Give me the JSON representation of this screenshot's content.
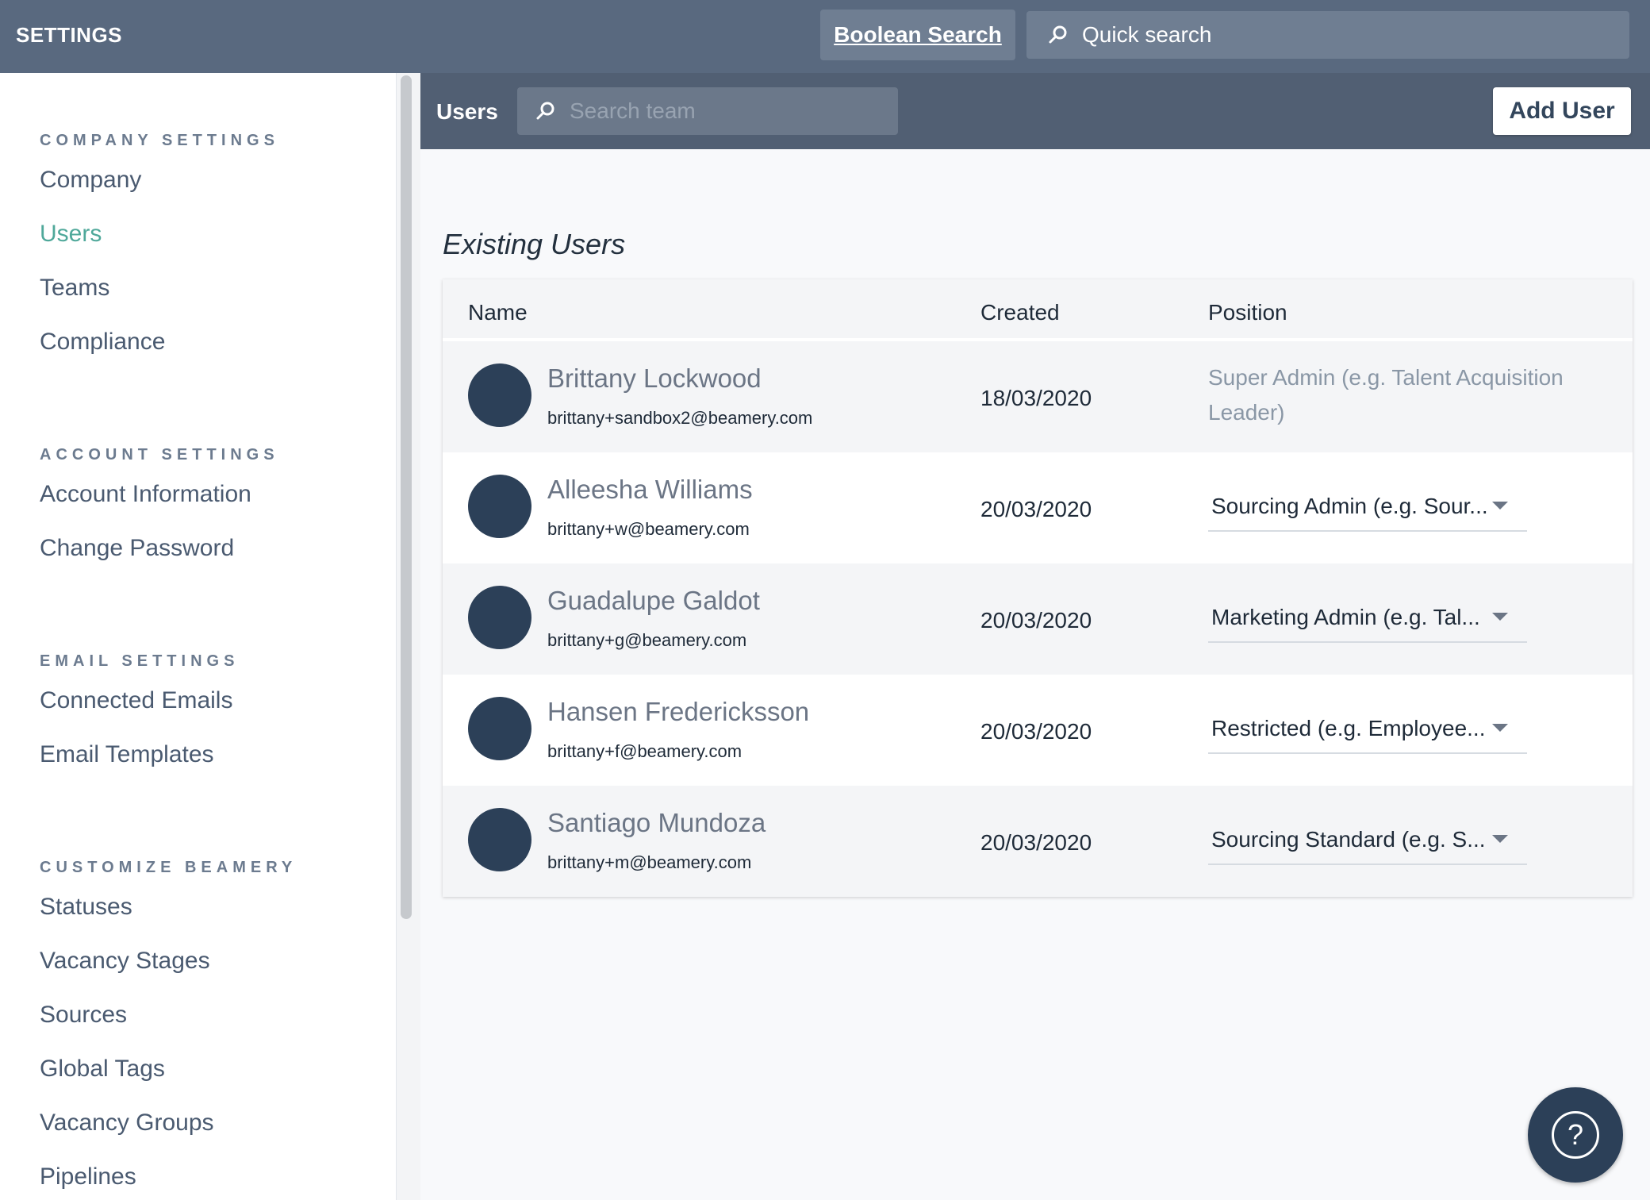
{
  "topbar": {
    "title": "SETTINGS",
    "boolean_search_label": "Boolean Search",
    "quick_search_placeholder": "Quick search"
  },
  "sidebar": {
    "sections": [
      {
        "title": "COMPANY SETTINGS",
        "items": [
          "Company",
          "Users",
          "Teams",
          "Compliance"
        ]
      },
      {
        "title": "ACCOUNT SETTINGS",
        "items": [
          "Account Information",
          "Change Password"
        ]
      },
      {
        "title": "EMAIL SETTINGS",
        "items": [
          "Connected Emails",
          "Email Templates"
        ]
      },
      {
        "title": "CUSTOMIZE BEAMERY",
        "items": [
          "Statuses",
          "Vacancy Stages",
          "Sources",
          "Global Tags",
          "Vacancy Groups",
          "Pipelines"
        ]
      }
    ],
    "active_item": "Users"
  },
  "content_header": {
    "title": "Users",
    "search_placeholder": "Search team",
    "add_user_label": "Add User"
  },
  "main": {
    "heading": "Existing Users",
    "columns": [
      "Name",
      "Created",
      "Position"
    ],
    "users": [
      {
        "name": "Brittany Lockwood",
        "email": "brittany+sandbox2@beamery.com",
        "created": "18/03/2020",
        "position": "Super Admin (e.g. Talent Acquisition Leader)",
        "editable": false
      },
      {
        "name": "Alleesha Williams",
        "email": "brittany+w@beamery.com",
        "created": "20/03/2020",
        "position": "Sourcing Admin (e.g. Sour...",
        "editable": true
      },
      {
        "name": "Guadalupe Galdot",
        "email": "brittany+g@beamery.com",
        "created": "20/03/2020",
        "position": "Marketing Admin (e.g. Tal...",
        "editable": true
      },
      {
        "name": "Hansen Fredericksson",
        "email": "brittany+f@beamery.com",
        "created": "20/03/2020",
        "position": "Restricted (e.g. Employee...",
        "editable": true
      },
      {
        "name": "Santiago Mundoza",
        "email": "brittany+m@beamery.com",
        "created": "20/03/2020",
        "position": "Sourcing Standard (e.g. S...",
        "editable": true
      }
    ]
  },
  "help": {
    "label": "?"
  },
  "colors": {
    "topbar": "#59697f",
    "content_header": "#515f73",
    "accent": "#4fa89a",
    "avatar": "#2c4058"
  }
}
